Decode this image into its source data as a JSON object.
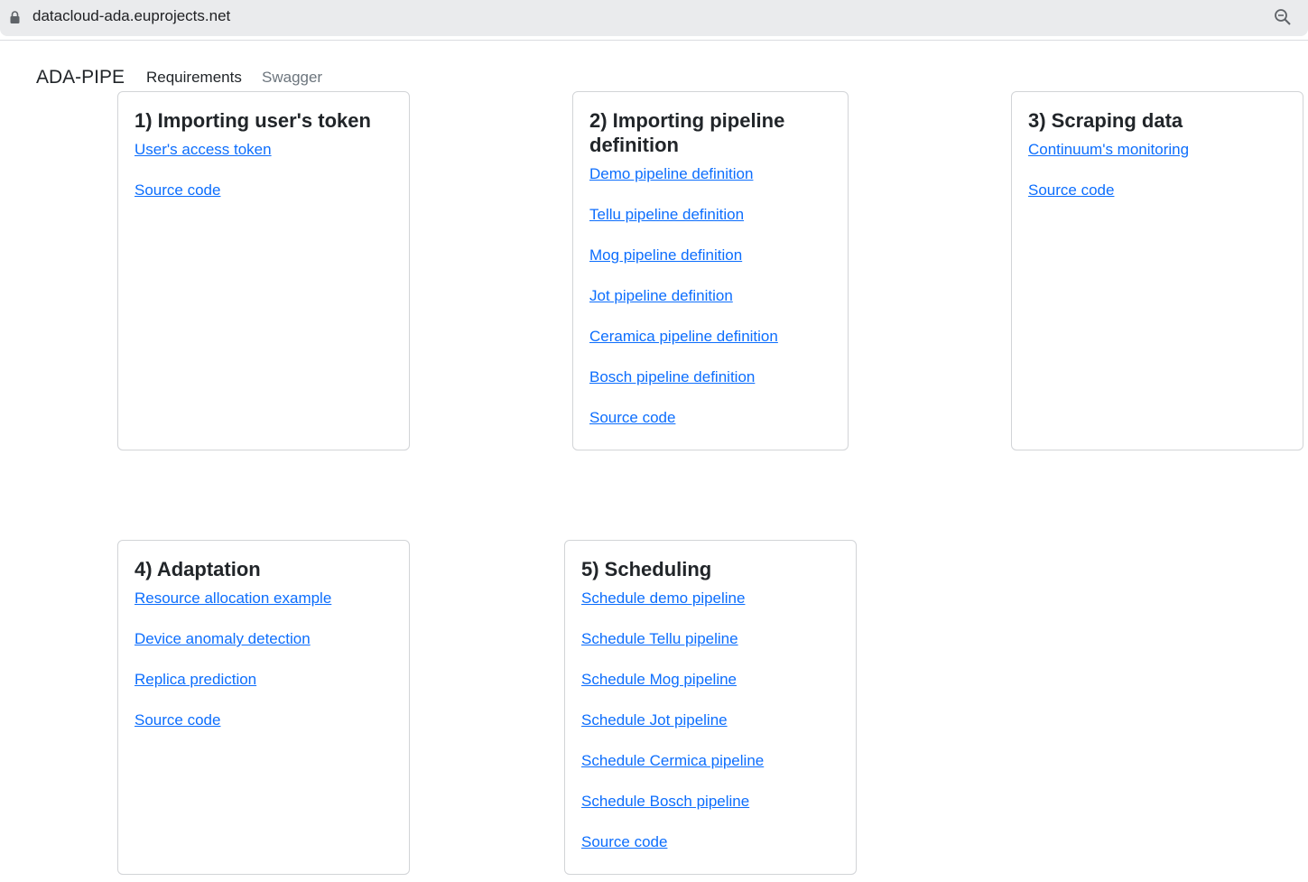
{
  "browser": {
    "url": "datacloud-ada.euprojects.net",
    "lock_icon": "lock-icon",
    "zoom_icon": "zoom-icon"
  },
  "navbar": {
    "brand": "ADA-PIPE",
    "links": [
      {
        "label": "Requirements",
        "state": "active"
      },
      {
        "label": "Swagger",
        "state": "inactive"
      }
    ]
  },
  "cards": [
    {
      "title": "1) Importing user's token",
      "links": [
        "User's access token",
        "Source code"
      ]
    },
    {
      "title": "2) Importing pipeline definition",
      "links": [
        "Demo pipeline definition",
        "Tellu pipeline definition",
        "Mog pipeline definition",
        "Jot pipeline definition",
        "Ceramica pipeline definition",
        "Bosch pipeline definition",
        "Source code"
      ]
    },
    {
      "title": "3) Scraping data",
      "links": [
        "Continuum's monitoring",
        "Source code"
      ]
    },
    {
      "title": "4) Adaptation",
      "links": [
        "Resource allocation example",
        "Device anomaly detection",
        "Replica prediction",
        "Source code"
      ]
    },
    {
      "title": "5) Scheduling",
      "links": [
        "Schedule demo pipeline",
        "Schedule Tellu pipeline",
        "Schedule Mog pipeline",
        "Schedule Jot pipeline",
        "Schedule Cermica pipeline",
        "Schedule Bosch pipeline",
        "Source code"
      ]
    }
  ],
  "colors": {
    "link": "#0d6efd",
    "text": "#212529",
    "muted": "#6c757d",
    "card_border": "#d2d4d7",
    "browser_bar": "#eaebed"
  }
}
